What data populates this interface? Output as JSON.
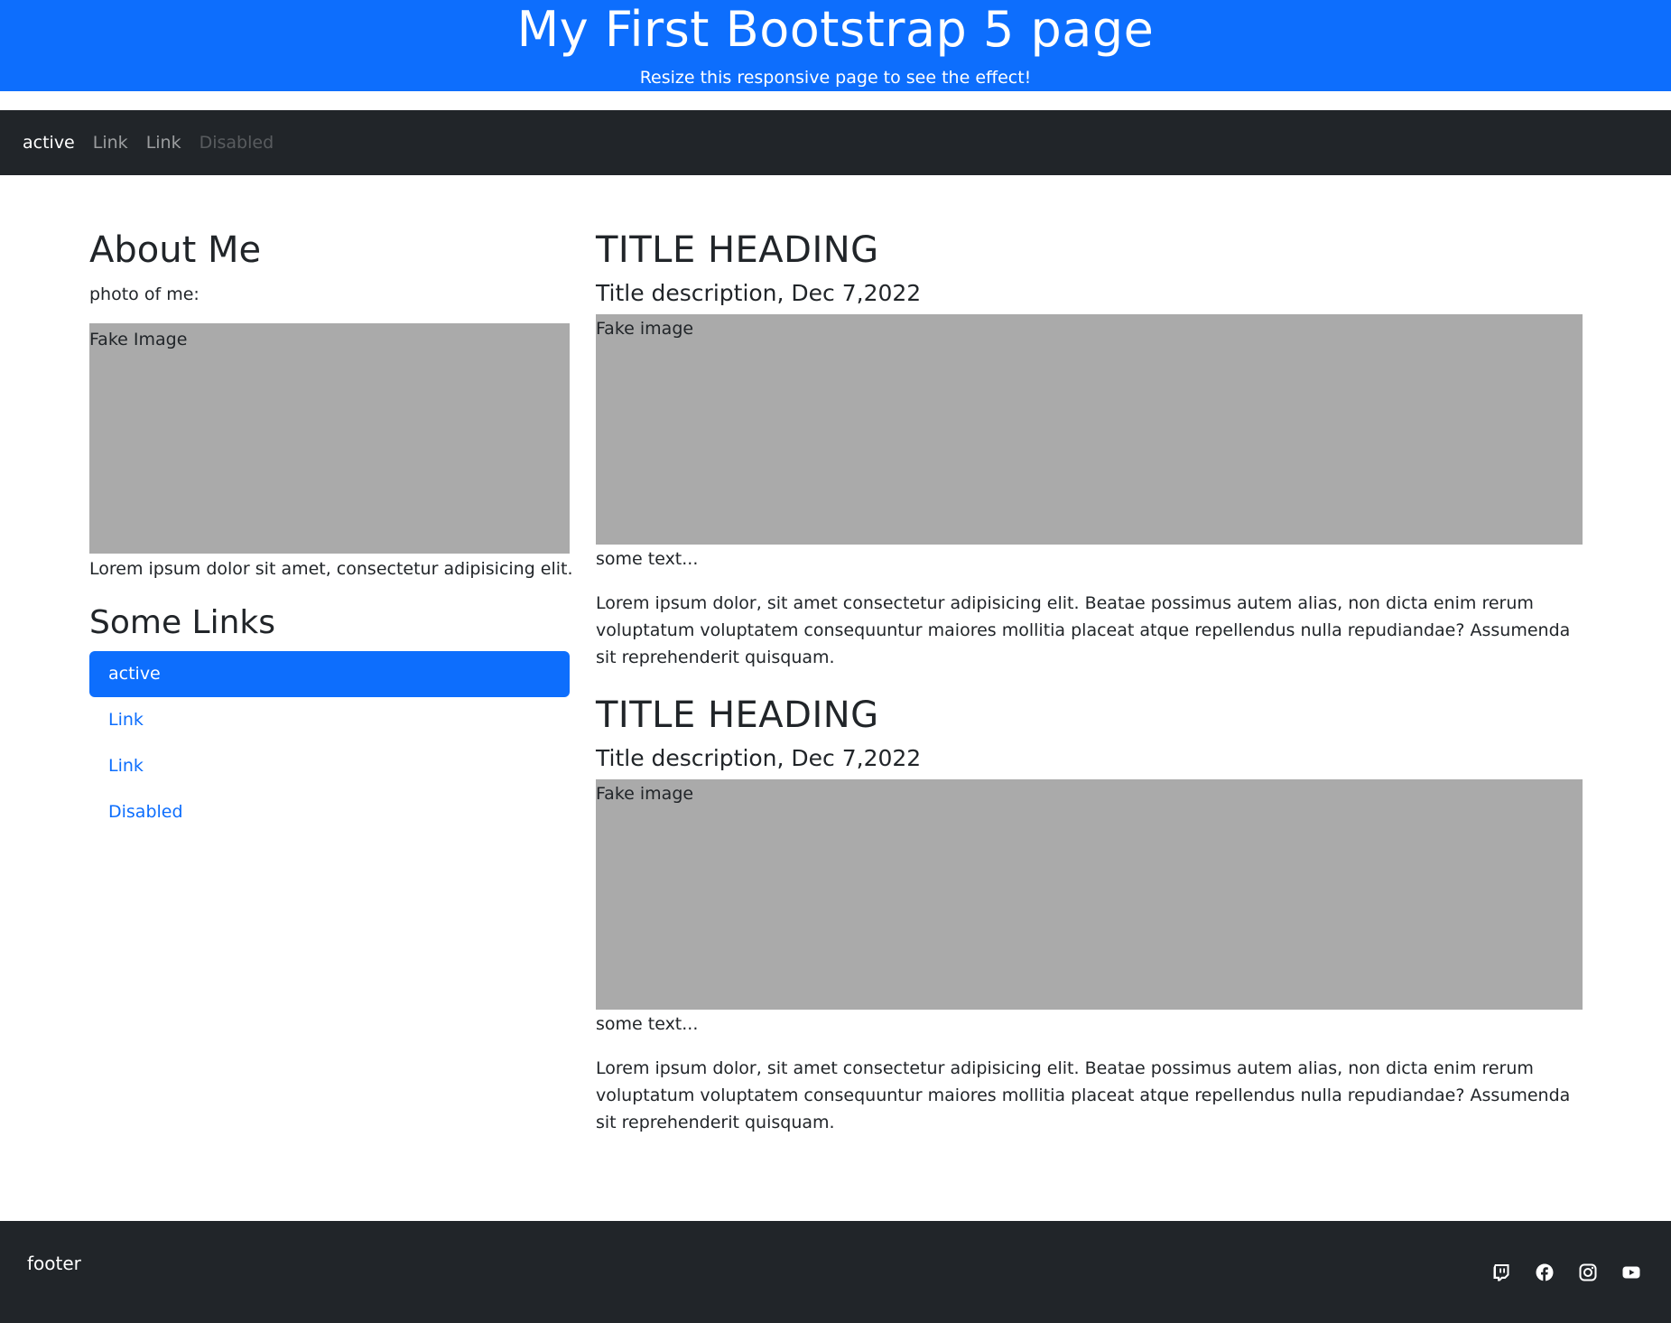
{
  "header": {
    "title": "My First Bootstrap 5 page",
    "subtitle": "Resize this responsive page to see the effect!"
  },
  "navbar": {
    "items": [
      {
        "label": "active",
        "state": "active"
      },
      {
        "label": "Link",
        "state": "normal"
      },
      {
        "label": "Link",
        "state": "normal"
      },
      {
        "label": "Disabled",
        "state": "disabled"
      }
    ]
  },
  "sidebar": {
    "about_title": "About Me",
    "photo_label": "photo of me:",
    "image_label": "Fake Image",
    "lorem": "Lorem ipsum dolor sit amet, consectetur adipisicing elit.",
    "links_title": "Some Links",
    "links": [
      {
        "label": "active",
        "state": "active"
      },
      {
        "label": "Link",
        "state": "normal"
      },
      {
        "label": "Link",
        "state": "normal"
      },
      {
        "label": "Disabled",
        "state": "disabled"
      }
    ]
  },
  "main": {
    "articles": [
      {
        "title": "TITLE HEADING",
        "description": "Title description, Dec 7,2022",
        "image_label": "Fake image",
        "some_text": "some text...",
        "body": "Lorem ipsum dolor, sit amet consectetur adipisicing elit. Beatae possimus autem alias, non dicta enim rerum voluptatum voluptatem consequuntur maiores mollitia placeat atque repellendus nulla repudiandae? Assumenda sit reprehenderit quisquam."
      },
      {
        "title": "TITLE HEADING",
        "description": "Title description, Dec 7,2022",
        "image_label": "Fake image",
        "some_text": "some text...",
        "body": "Lorem ipsum dolor, sit amet consectetur adipisicing elit. Beatae possimus autem alias, non dicta enim rerum voluptatum voluptatem consequuntur maiores mollitia placeat atque repellendus nulla repudiandae? Assumenda sit reprehenderit quisquam."
      }
    ]
  },
  "footer": {
    "text": "footer",
    "icons": [
      "twitch-icon",
      "facebook-icon",
      "instagram-icon",
      "youtube-icon"
    ]
  },
  "colors": {
    "primary": "#0d6efd",
    "dark": "#212529",
    "placeholder": "#aaaaaa"
  }
}
